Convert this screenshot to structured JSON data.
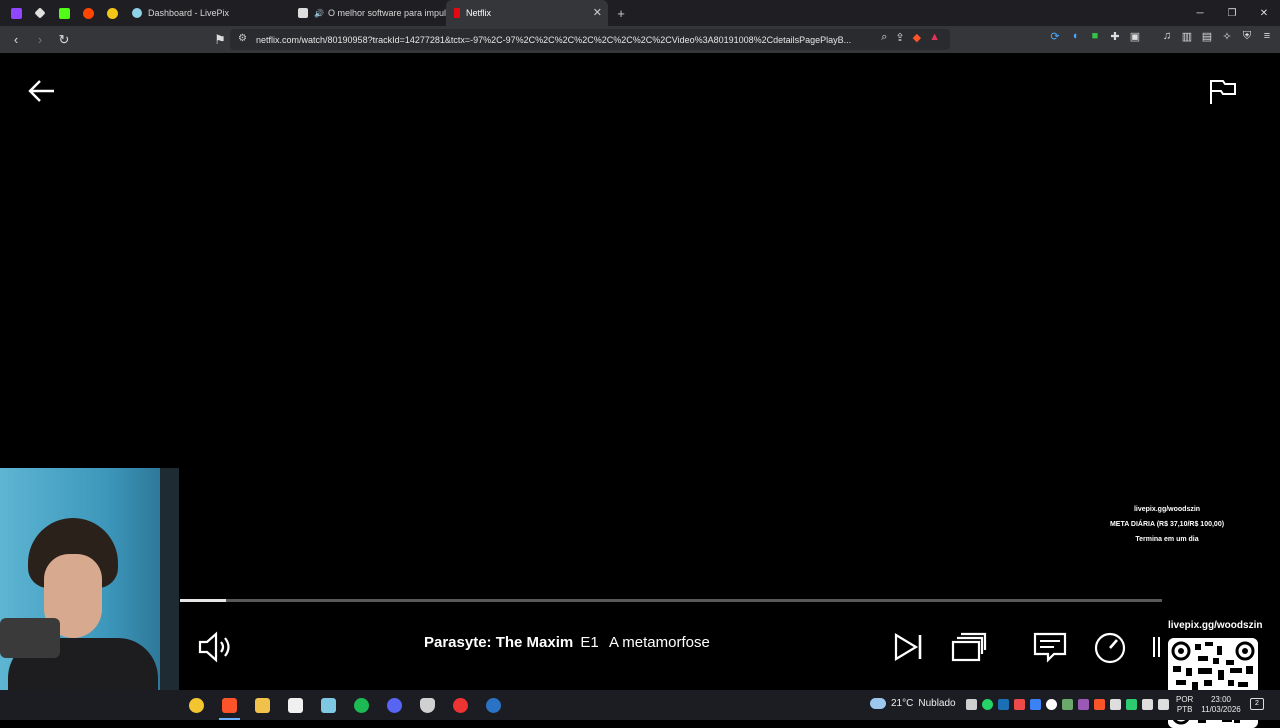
{
  "browser": {
    "tabs": [
      {
        "title": "Dashboard - LivePix",
        "active": false
      },
      {
        "title": "O melhor software para impulsio",
        "active": false
      },
      {
        "title": "Netflix",
        "active": true
      }
    ],
    "new_tab": "+",
    "url": "netflix.com/watch/80190958?trackId=14277281&tctx=-97%2C-97%2C%2C%2C%2C%2C%2C%2C%2CVideo%3A80191008%2CdetailsPagePlayB..."
  },
  "overlay": {
    "livepix_url": "livepix.gg/woodszin",
    "goal": "META DIÁRIA (R$ 37,10/R$ 100,00)",
    "ends": "Termina em um dia",
    "qr_label": "livepix.gg/woodszin"
  },
  "player": {
    "show_title": "Parasyte: The Maxim",
    "episode": "E1",
    "episode_title": "A metamorfose",
    "progress": 0.047
  },
  "taskbar": {
    "weather_temp": "21°C",
    "weather_desc": "Nublado",
    "lang_line1": "POR",
    "lang_line2": "PTB",
    "time": "23:00",
    "date": "11/03/2026",
    "notifications": "2"
  }
}
